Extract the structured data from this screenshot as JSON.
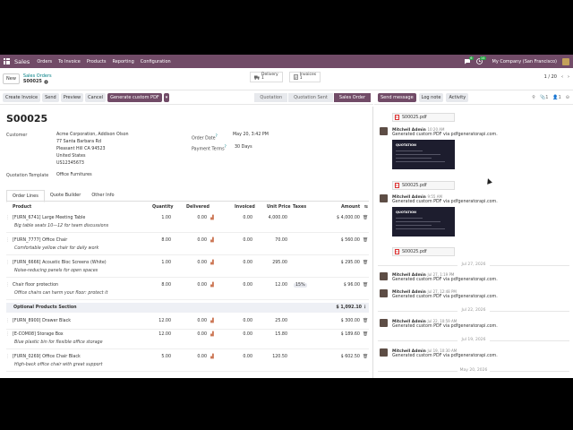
{
  "topbar": {
    "app": "Sales",
    "menus": [
      "Orders",
      "To Invoice",
      "Products",
      "Reporting",
      "Configuration"
    ],
    "msg_count": "6",
    "activity_count": "14",
    "company": "My Company (San Francisco)"
  },
  "control": {
    "new_label": "New",
    "breadcrumb_parent": "Sales Orders",
    "breadcrumb_current": "S00025",
    "delivery_label": "Delivery",
    "delivery_count": "1",
    "invoices_label": "Invoices",
    "invoices_count": "1",
    "pager": "1 / 20"
  },
  "actions": {
    "create_invoice": "Create Invoice",
    "send": "Send",
    "preview": "Preview",
    "cancel": "Cancel",
    "custom_pdf": "Generate custom PDF",
    "statuses": [
      "Quotation",
      "Quotation Sent",
      "Sales Order"
    ]
  },
  "form": {
    "title": "S00025",
    "customer_label": "Customer",
    "customer_lines": [
      "Acme Corporation, Addison Olson",
      "77 Santa Barbara Rd",
      "Pleasant Hill CA 94523",
      "United States",
      "US12345673"
    ],
    "order_date_label": "Order Date",
    "order_date_sup": "?",
    "order_date": "May 20, 3:42 PM",
    "payment_terms_label": "Payment Terms",
    "payment_terms_sup": "?",
    "payment_terms": "30 Days",
    "quotation_template_label": "Quotation Template",
    "quotation_template": "Office Furnitures",
    "tabs": [
      "Order Lines",
      "Quote Builder",
      "Other Info"
    ]
  },
  "lines": {
    "headers": {
      "product": "Product",
      "quantity": "Quantity",
      "delivered": "Delivered",
      "invoiced": "Invoiced",
      "unit_price": "Unit Price",
      "taxes": "Taxes",
      "amount": "Amount"
    },
    "rows": [
      {
        "product": "[FURN_6741] Large Meeting Table",
        "desc": "Big table seats 10—12 for team discussions",
        "qty": "1.00",
        "delivered": "0.00",
        "invoiced": "0.00",
        "price": "4,000.00",
        "tax": "",
        "amount": "$ 4,000.00"
      },
      {
        "product": "[FURN_7777] Office Chair",
        "desc": "Comfortable yellow chair for daily work",
        "qty": "8.00",
        "delivered": "0.00",
        "invoiced": "0.00",
        "price": "70.00",
        "tax": "",
        "amount": "$ 560.00"
      },
      {
        "product": "[FURN_6666] Acoustic Bloc Screens (White)",
        "desc": "Noise-reducing panels for open spaces",
        "qty": "1.00",
        "delivered": "0.00",
        "invoiced": "0.00",
        "price": "295.00",
        "tax": "",
        "amount": "$ 295.00"
      },
      {
        "product": "Chair floor protection",
        "desc": "Office chairs can harm your floor: protect it",
        "qty": "8.00",
        "delivered": "0.00",
        "invoiced": "0.00",
        "price": "12.00",
        "tax": "15%",
        "amount": "$ 96.00"
      }
    ],
    "section": {
      "label": "Optional Products Section",
      "amount": "$ 1,092.10"
    },
    "optional_rows": [
      {
        "product": "[FURN_8900] Drawer Black",
        "desc": "",
        "qty": "12.00",
        "delivered": "0.00",
        "invoiced": "0.00",
        "price": "25.00",
        "tax": "",
        "amount": "$ 300.00"
      },
      {
        "product": "[E-COM08] Storage Box",
        "desc": "Blue plastic bin for flexible office storage",
        "qty": "12.00",
        "delivered": "0.00",
        "invoiced": "0.00",
        "price": "15.80",
        "tax": "",
        "amount": "$ 189.60"
      },
      {
        "product": "[FURN_0269] Office Chair Black",
        "desc": "High-back office chair with great support",
        "qty": "5.00",
        "delivered": "0.00",
        "invoiced": "0.00",
        "price": "120.50",
        "tax": "",
        "amount": "$ 602.50"
      }
    ]
  },
  "chatter": {
    "send_message": "Send message",
    "log_note": "Log note",
    "activity": "Activity",
    "attachment_count": "1",
    "follower_count": "1",
    "pdf_name": "S00025.pdf",
    "thumb_title": "QUOTATION",
    "messages": [
      {
        "author": "Mitchell Admin",
        "time": "10:20 AM",
        "text": "Generated custom PDF via pdfgeneratorapi.com."
      },
      {
        "author": "Mitchell Admin",
        "time": "9:55 AM",
        "text": "Generated custom PDF via pdfgeneratorapi.com."
      },
      {
        "author": "Mitchell Admin",
        "time": "Jul 27, 1:19 PM",
        "text": "Generated custom PDF via pdfgeneratorapi.com."
      },
      {
        "author": "Mitchell Admin",
        "time": "Jul 27, 12:48 PM",
        "text": "Generated custom PDF via pdfgeneratorapi.com."
      },
      {
        "author": "Mitchell Admin",
        "time": "Jul 22, 10:59 AM",
        "text": "Generated custom PDF via pdfgeneratorapi.com."
      },
      {
        "author": "Mitchell Admin",
        "time": "Jul 19, 10:30 AM",
        "text": "Generated custom PDF via pdfgeneratorapi.com."
      }
    ],
    "days": [
      "Jul 27, 2026",
      "Jul 22, 2026",
      "Jul 19, 2026",
      "May 20, 2026"
    ]
  },
  "colors": {
    "brand": "#714b67",
    "teal": "#017e84"
  }
}
